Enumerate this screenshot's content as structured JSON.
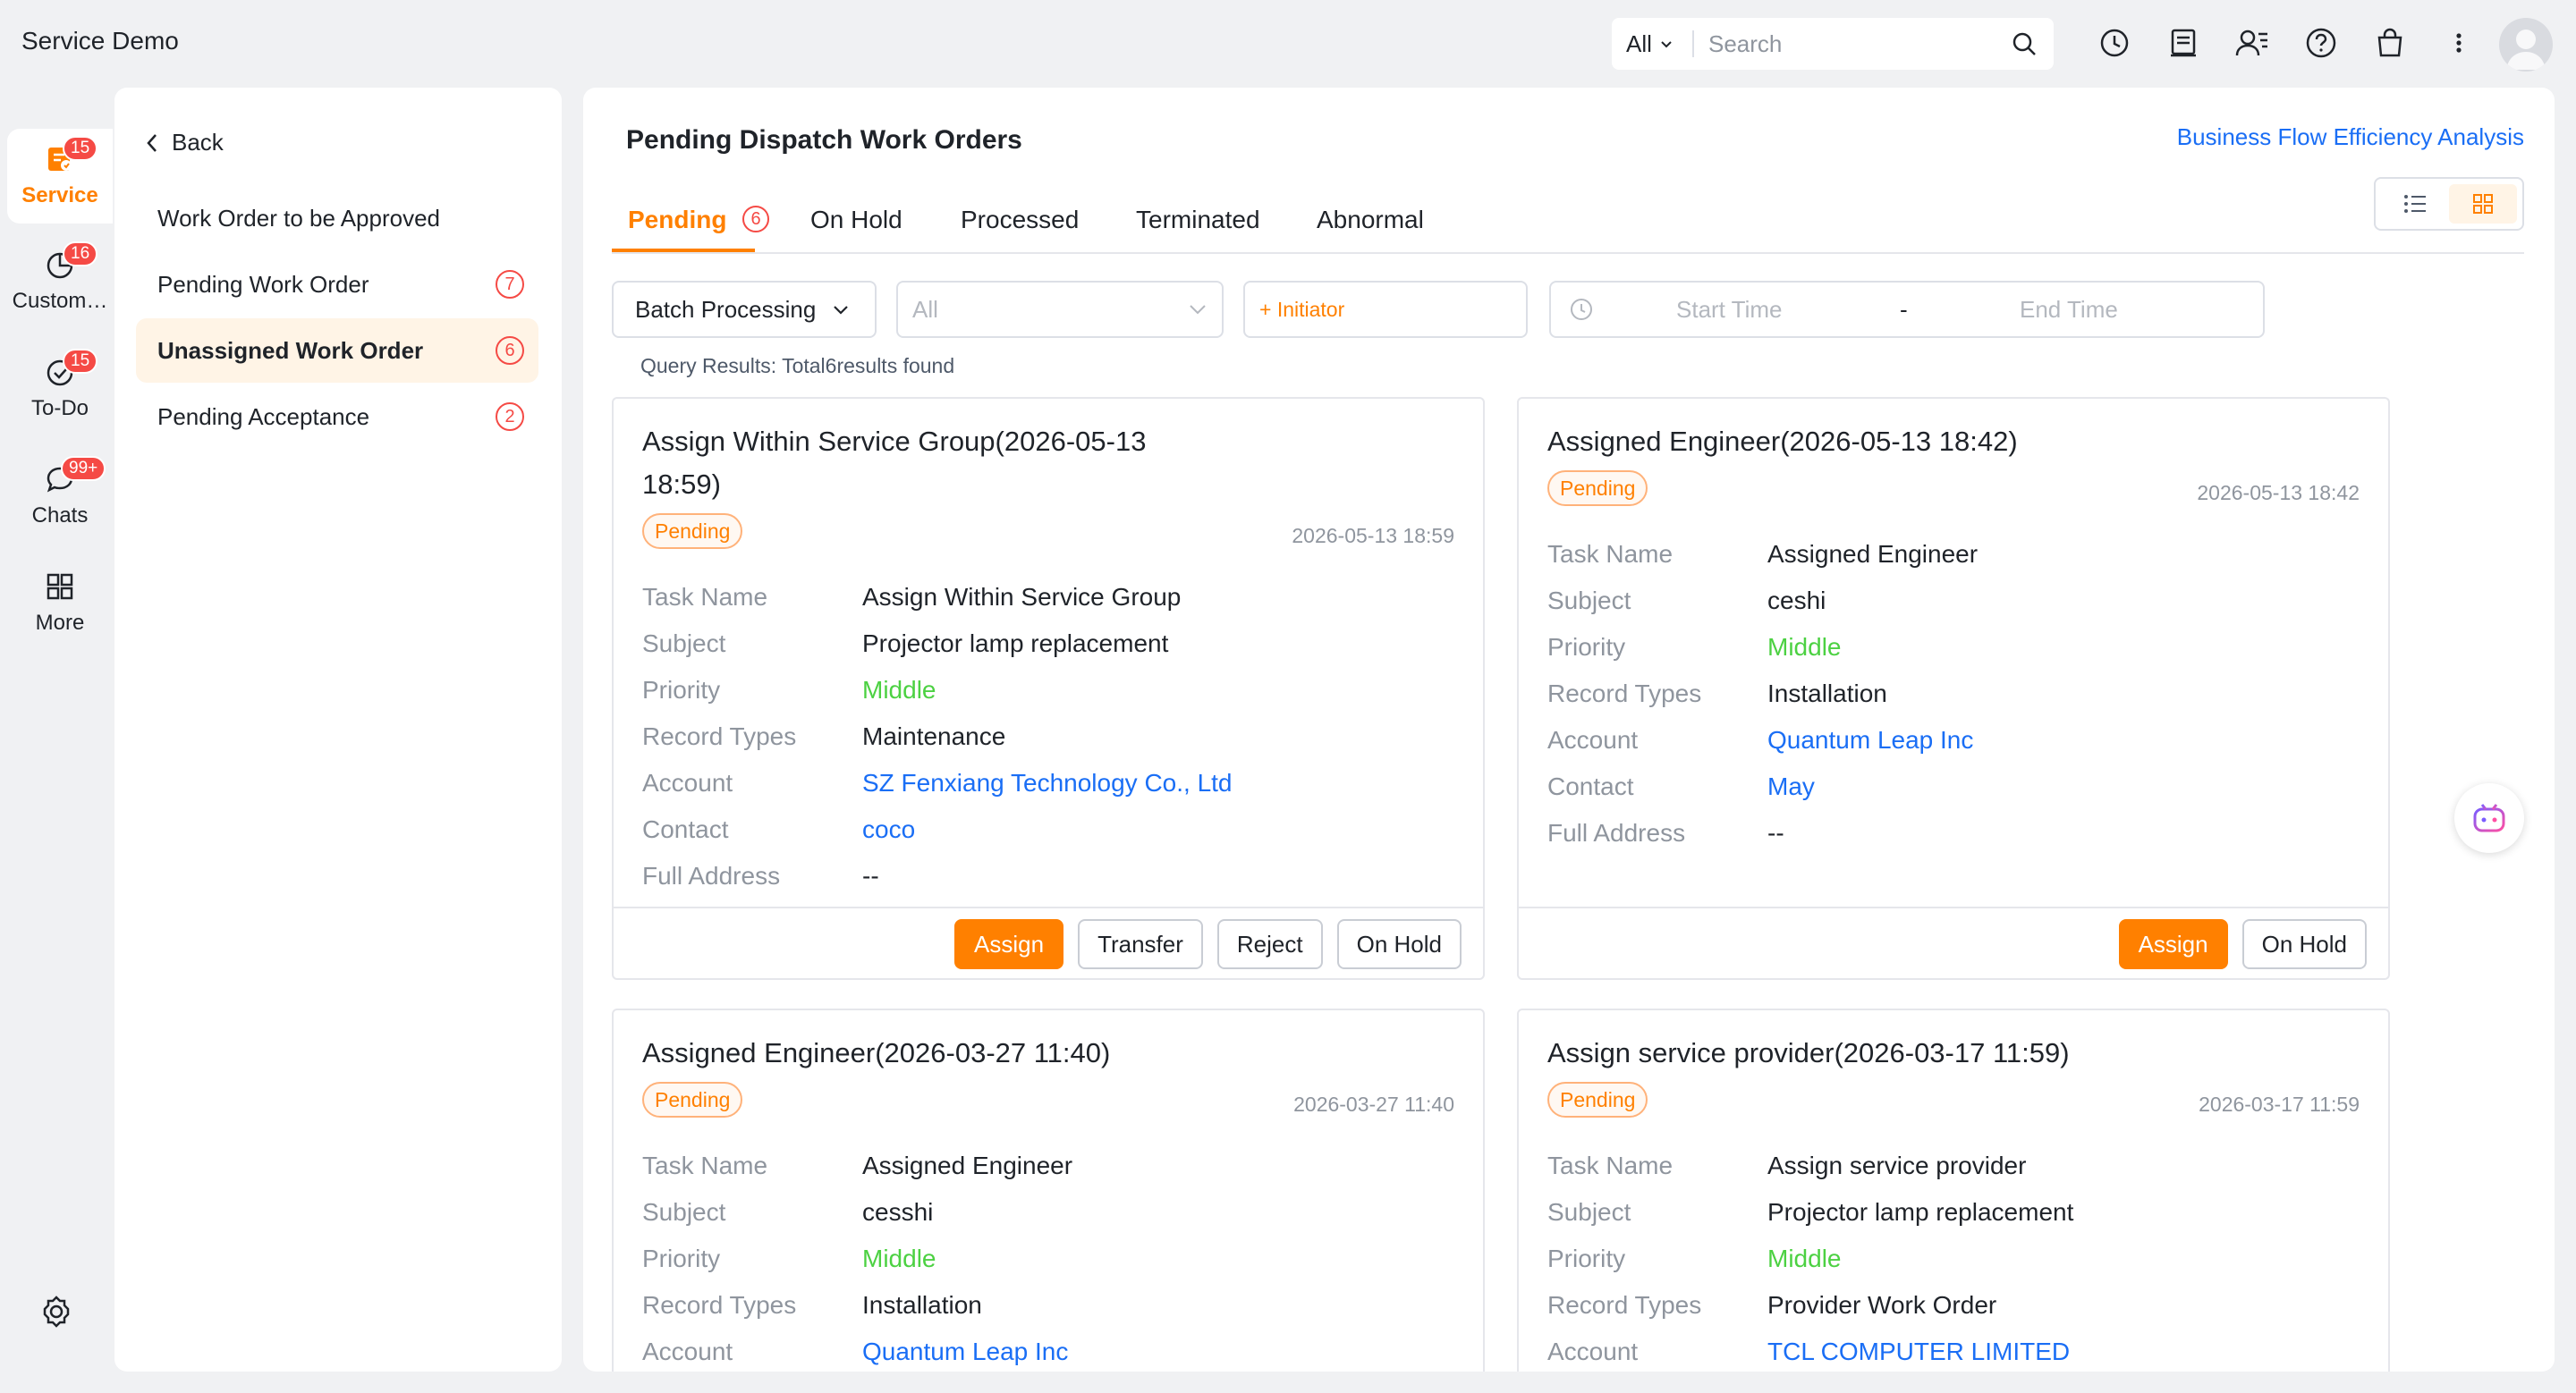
{
  "app": {
    "title": "Service Demo"
  },
  "search": {
    "scope": "All",
    "placeholder": "Search"
  },
  "topbar_icons": [
    "clock-icon",
    "ledger-icon",
    "contacts-icon",
    "help-icon",
    "bag-icon",
    "more-vertical-icon"
  ],
  "rail": [
    {
      "label": "Service",
      "badge": "15",
      "icon": "service-icon",
      "active": true
    },
    {
      "label": "Custom…",
      "badge": "16",
      "icon": "pie-chart-icon"
    },
    {
      "label": "To-Do",
      "badge": "15",
      "icon": "check-circle-icon"
    },
    {
      "label": "Chats",
      "badge": "99+",
      "icon": "chat-bubble-icon"
    },
    {
      "label": "More",
      "icon": "grid-icon"
    }
  ],
  "leftpanel": {
    "back": "Back",
    "items": [
      {
        "label": "Work Order to be Approved"
      },
      {
        "label": "Pending Work Order",
        "count": "7"
      },
      {
        "label": "Unassigned Work Order",
        "count": "6",
        "active": true
      },
      {
        "label": "Pending Acceptance",
        "count": "2"
      }
    ]
  },
  "main": {
    "title": "Pending Dispatch Work Orders",
    "analysis_link": "Business Flow Efficiency Analysis",
    "tabs": [
      {
        "label": "Pending",
        "count": "6",
        "active": true
      },
      {
        "label": "On Hold"
      },
      {
        "label": "Processed"
      },
      {
        "label": "Terminated"
      },
      {
        "label": "Abnormal"
      }
    ],
    "filters": {
      "batch": "Batch Processing",
      "all_placeholder": "All",
      "initiator": "+ Initiator",
      "start_time": "Start Time",
      "separator": "-",
      "end_time": "End Time"
    },
    "query": "Query Results:  Total6results found"
  },
  "field_labels": {
    "task": "Task Name",
    "subject": "Subject",
    "priority": "Priority",
    "record": "Record Types",
    "account": "Account",
    "contact": "Contact",
    "address": "Full Address"
  },
  "cards": [
    {
      "title": "Assign Within Service Group(2026-05-13 18:59)",
      "status": "Pending",
      "date": "2026-05-13 18:59",
      "task": "Assign Within Service Group",
      "subject": "Projector lamp replacement",
      "priority": "Middle",
      "record": "Maintenance",
      "account": "SZ Fenxiang Technology Co., Ltd",
      "contact": "coco",
      "address": "--",
      "buttons": [
        "Assign",
        "Transfer",
        "Reject",
        "On Hold"
      ]
    },
    {
      "title": "Assigned Engineer(2026-05-13 18:42)",
      "status": "Pending",
      "date": "2026-05-13 18:42",
      "task": "Assigned Engineer",
      "subject": "ceshi",
      "priority": "Middle",
      "record": "Installation",
      "account": "Quantum Leap Inc",
      "contact": "May",
      "address": "--",
      "buttons": [
        "Assign",
        "On Hold"
      ]
    },
    {
      "title": "Assigned Engineer(2026-03-27 11:40)",
      "status": "Pending",
      "date": "2026-03-27 11:40",
      "task": "Assigned Engineer",
      "subject": "cesshi",
      "priority": "Middle",
      "record": "Installation",
      "account": "Quantum Leap Inc"
    },
    {
      "title": "Assign service provider(2026-03-17 11:59)",
      "status": "Pending",
      "date": "2026-03-17 11:59",
      "task": "Assign service provider",
      "subject": "Projector lamp replacement",
      "priority": "Middle",
      "record": "Provider Work Order",
      "account": "TCL COMPUTER LIMITED"
    }
  ],
  "colors": {
    "accent": "#ff8000",
    "link": "#1a6ef5",
    "priority_middle": "#4cd142",
    "badge": "#f54a45"
  }
}
